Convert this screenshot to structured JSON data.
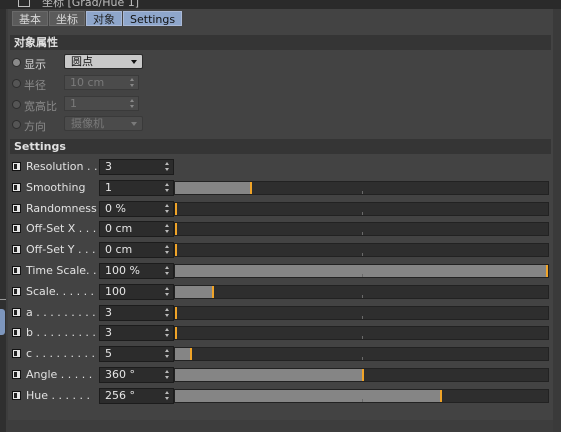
{
  "window": {
    "title": "坐标 [Grad/Hue 1]"
  },
  "tabs": [
    {
      "label": "基本",
      "active": false
    },
    {
      "label": "坐标",
      "active": false
    },
    {
      "label": "对象",
      "active": true
    },
    {
      "label": "Settings",
      "active": true
    }
  ],
  "object_section": {
    "title": "对象属性",
    "display": {
      "label": "显示",
      "value": "圆点"
    },
    "radius": {
      "label": "半径",
      "value": "10 cm"
    },
    "aspect": {
      "label": "宽高比",
      "value": "1"
    },
    "direction": {
      "label": "方向",
      "value": "摄像机"
    }
  },
  "settings_section": {
    "title": "Settings",
    "rows": [
      {
        "label": "Resolution . .",
        "value": "3",
        "slider": false
      },
      {
        "label": "Smoothing",
        "value": "1",
        "slider": true,
        "fraction": 0.2
      },
      {
        "label": "Randomness",
        "value": "0 %",
        "slider": true,
        "fraction": 0.0
      },
      {
        "label": "Off-Set X . . .",
        "value": "0 cm",
        "slider": true,
        "fraction": 0.0
      },
      {
        "label": "Off-Set Y . . .",
        "value": "0 cm",
        "slider": true,
        "fraction": 0.0
      },
      {
        "label": "Time Scale. .",
        "value": "100 %",
        "slider": true,
        "fraction": 1.0
      },
      {
        "label": "Scale. . . . . .",
        "value": "100",
        "slider": true,
        "fraction": 0.1
      },
      {
        "label": "a . . . . . . . . . .",
        "value": "3",
        "slider": true,
        "fraction": 0.0
      },
      {
        "label": "b . . . . . . . . . .",
        "value": "3",
        "slider": true,
        "fraction": 0.0
      },
      {
        "label": "c . . . . . . . . . .",
        "value": "5",
        "slider": true,
        "fraction": 0.04
      },
      {
        "label": "Angle . . . . .",
        "value": "360 °",
        "slider": true,
        "fraction": 0.5
      },
      {
        "label": "Hue . . . . . .",
        "value": "256 °",
        "slider": true,
        "fraction": 0.71
      }
    ]
  },
  "colors": {
    "panel": "#434343",
    "header": "#353535",
    "tab_active": "#8ea6cb",
    "slider_fill": "#858585",
    "slider_handle": "#f0a428"
  }
}
